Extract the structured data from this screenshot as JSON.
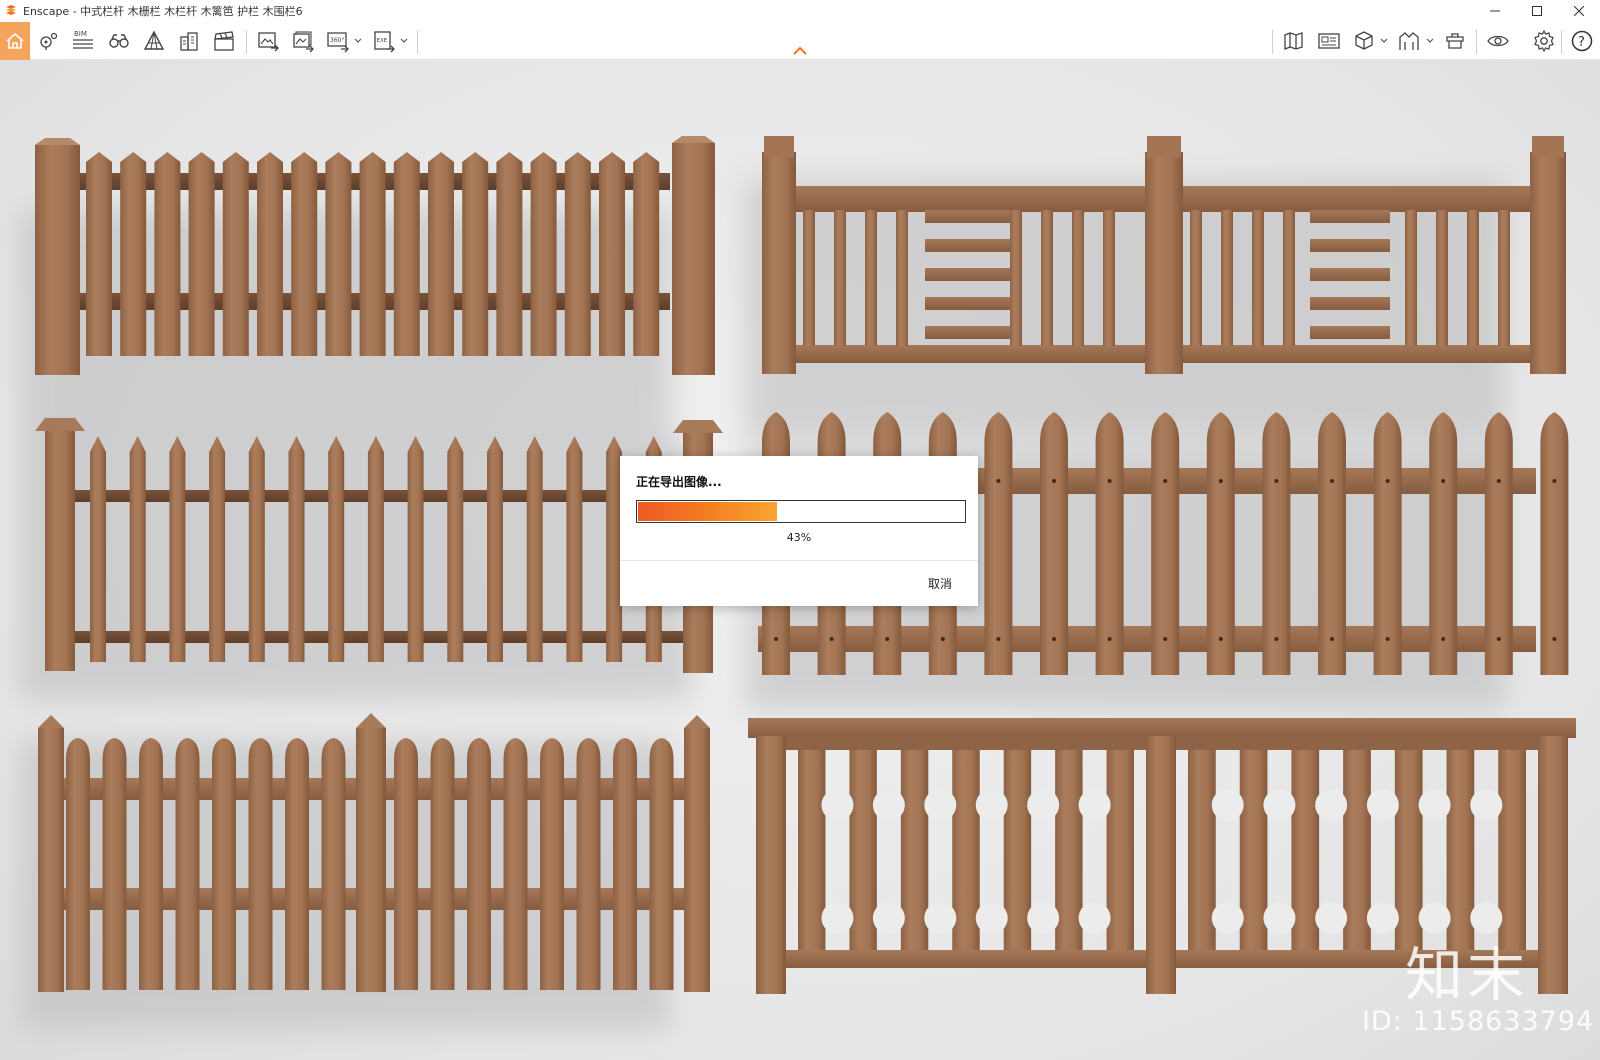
{
  "window": {
    "title": "Enscape - 中式栏杆 木栅栏 木栏杆 木篱笆 护栏 木围栏6"
  },
  "toolbar": {
    "left_icons": [
      "home-icon",
      "location-pin-icon",
      "bim-icon",
      "binoculars-icon",
      "perspective-icon",
      "buildings-icon",
      "clapper-icon",
      "export-image-icon",
      "batch-export-icon",
      "panorama-360-icon",
      "exe-export-icon"
    ],
    "bim_label": "BIM",
    "pano_label": "360°",
    "exe_label": "EXE",
    "right_icons": [
      "map-icon",
      "views-icon",
      "cube-icon",
      "arch-icon",
      "asset-library-icon",
      "visual-settings-icon",
      "settings-icon",
      "help-icon"
    ],
    "help_label": "?"
  },
  "dialog": {
    "title": "正在导出图像...",
    "progress_percent": 43,
    "percent_label": "43%",
    "cancel_label": "取消"
  },
  "watermark": {
    "logo_text": "知末",
    "id_text": "ID: 1158633794"
  },
  "colors": {
    "accent": "#f6a45c",
    "wood": "#a47656",
    "background": "#e9e9ea"
  }
}
